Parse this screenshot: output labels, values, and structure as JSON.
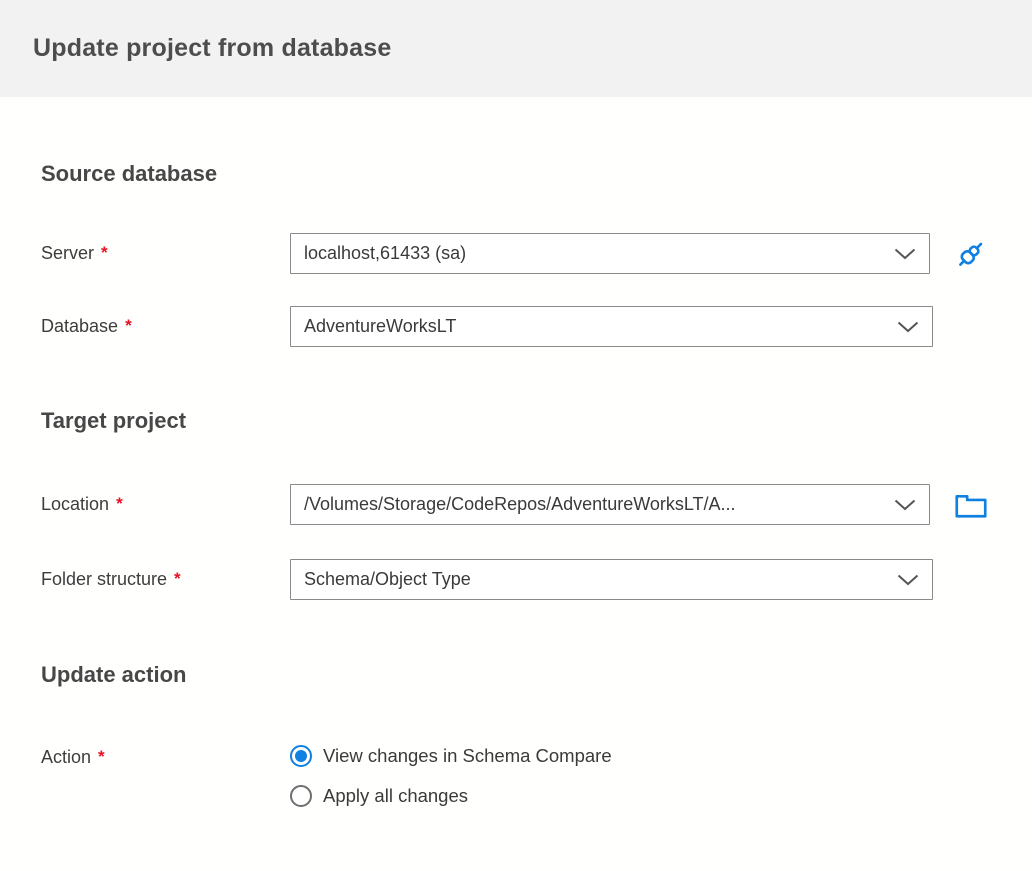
{
  "header": {
    "title": "Update project from database"
  },
  "sections": {
    "source_database": {
      "heading": "Source database"
    },
    "target_project": {
      "heading": "Target project"
    },
    "update_action": {
      "heading": "Update action"
    }
  },
  "required_marker": "*",
  "fields": {
    "server": {
      "label": "Server",
      "required": true,
      "value": "localhost,61433 (sa)",
      "icon": "plug-connect-icon"
    },
    "database": {
      "label": "Database",
      "required": true,
      "value": "AdventureWorksLT"
    },
    "location": {
      "label": "Location",
      "required": true,
      "value": "/Volumes/Storage/CodeRepos/AdventureWorksLT/A...",
      "icon": "folder-icon"
    },
    "folder_structure": {
      "label": "Folder structure",
      "required": true,
      "value": "Schema/Object Type"
    },
    "action": {
      "label": "Action",
      "required": true,
      "options": [
        {
          "label": "View changes in Schema Compare",
          "selected": true
        },
        {
          "label": "Apply all changes",
          "selected": false
        }
      ]
    }
  },
  "colors": {
    "accent_blue": "#1080e1",
    "required_red": "#e81123",
    "header_background": "#f2f2f2",
    "field_border": "#8a8a8a",
    "text": "#3c3c3c"
  }
}
